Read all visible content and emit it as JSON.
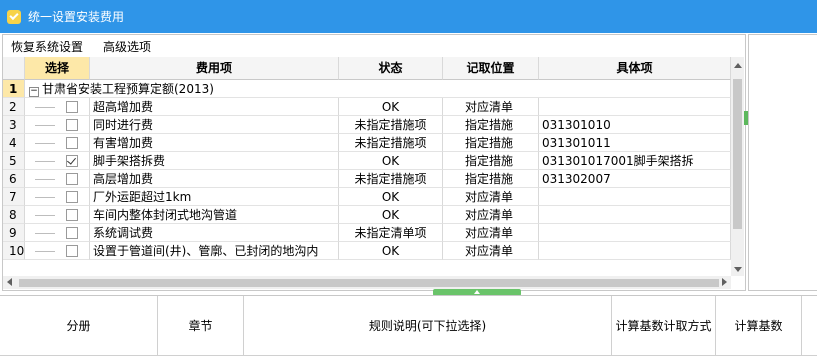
{
  "window": {
    "title": "统一设置安装费用",
    "icon": "app-check-icon"
  },
  "menu": {
    "items": [
      "恢复系统设置",
      "高级选项"
    ]
  },
  "grid": {
    "headers": {
      "select": "选择",
      "item": "费用项",
      "status": "状态",
      "location": "记取位置",
      "detail": "具体项"
    },
    "group": {
      "num": "1",
      "expander": "−",
      "label": "甘肃省安装工程预算定额(2013)"
    },
    "rows": [
      {
        "num": "2",
        "checked": false,
        "item": "超高增加费",
        "status": "OK",
        "location": "对应清单",
        "detail": ""
      },
      {
        "num": "3",
        "checked": false,
        "item": "同时进行费",
        "status": "未指定措施项",
        "location": "指定措施",
        "detail": "031301010"
      },
      {
        "num": "4",
        "checked": false,
        "item": "有害增加费",
        "status": "未指定措施项",
        "location": "指定措施",
        "detail": "031301011"
      },
      {
        "num": "5",
        "checked": true,
        "item": "脚手架搭拆费",
        "status": "OK",
        "location": "指定措施",
        "detail": "031301017001脚手架搭拆"
      },
      {
        "num": "6",
        "checked": false,
        "item": "高层增加费",
        "status": "未指定措施项",
        "location": "指定措施",
        "detail": "031302007"
      },
      {
        "num": "7",
        "checked": false,
        "item": "厂外运距超过1km",
        "status": "OK",
        "location": "对应清单",
        "detail": ""
      },
      {
        "num": "8",
        "checked": false,
        "item": "车间内整体封闭式地沟管道",
        "status": "OK",
        "location": "对应清单",
        "detail": ""
      },
      {
        "num": "9",
        "checked": false,
        "item": "系统调试费",
        "status": "未指定清单项",
        "location": "对应清单",
        "detail": ""
      },
      {
        "num": "10",
        "checked": false,
        "item": "设置于管道间(井)、管廓、已封闭的地沟内",
        "status": "OK",
        "location": "对应清单",
        "detail": ""
      }
    ]
  },
  "bottom": {
    "headers": [
      "分册",
      "章节",
      "规则说明(可下拉选择)",
      "计算基数计取方式",
      "计算基数"
    ]
  },
  "colors": {
    "titlebar": "#2f95e8",
    "accent_green": "#6ac46a",
    "selected_header": "#fde8a8"
  }
}
